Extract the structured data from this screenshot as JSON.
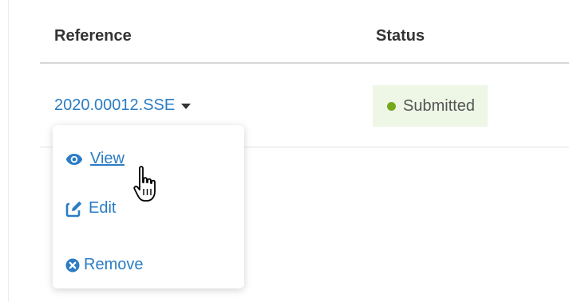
{
  "table": {
    "headers": {
      "reference": "Reference",
      "status": "Status"
    },
    "rows": [
      {
        "reference": "2020.00012.SSE",
        "status": "Submitted",
        "status_color": "#77a81c"
      }
    ]
  },
  "dropdown": {
    "items": [
      {
        "label": "View",
        "icon": "eye-icon"
      },
      {
        "label": "Edit",
        "icon": "edit-icon"
      },
      {
        "label": "Remove",
        "icon": "remove-icon"
      }
    ]
  },
  "colors": {
    "link": "#2b7cc4",
    "status_bg": "#eef6e6",
    "status_dot": "#77a81c"
  }
}
